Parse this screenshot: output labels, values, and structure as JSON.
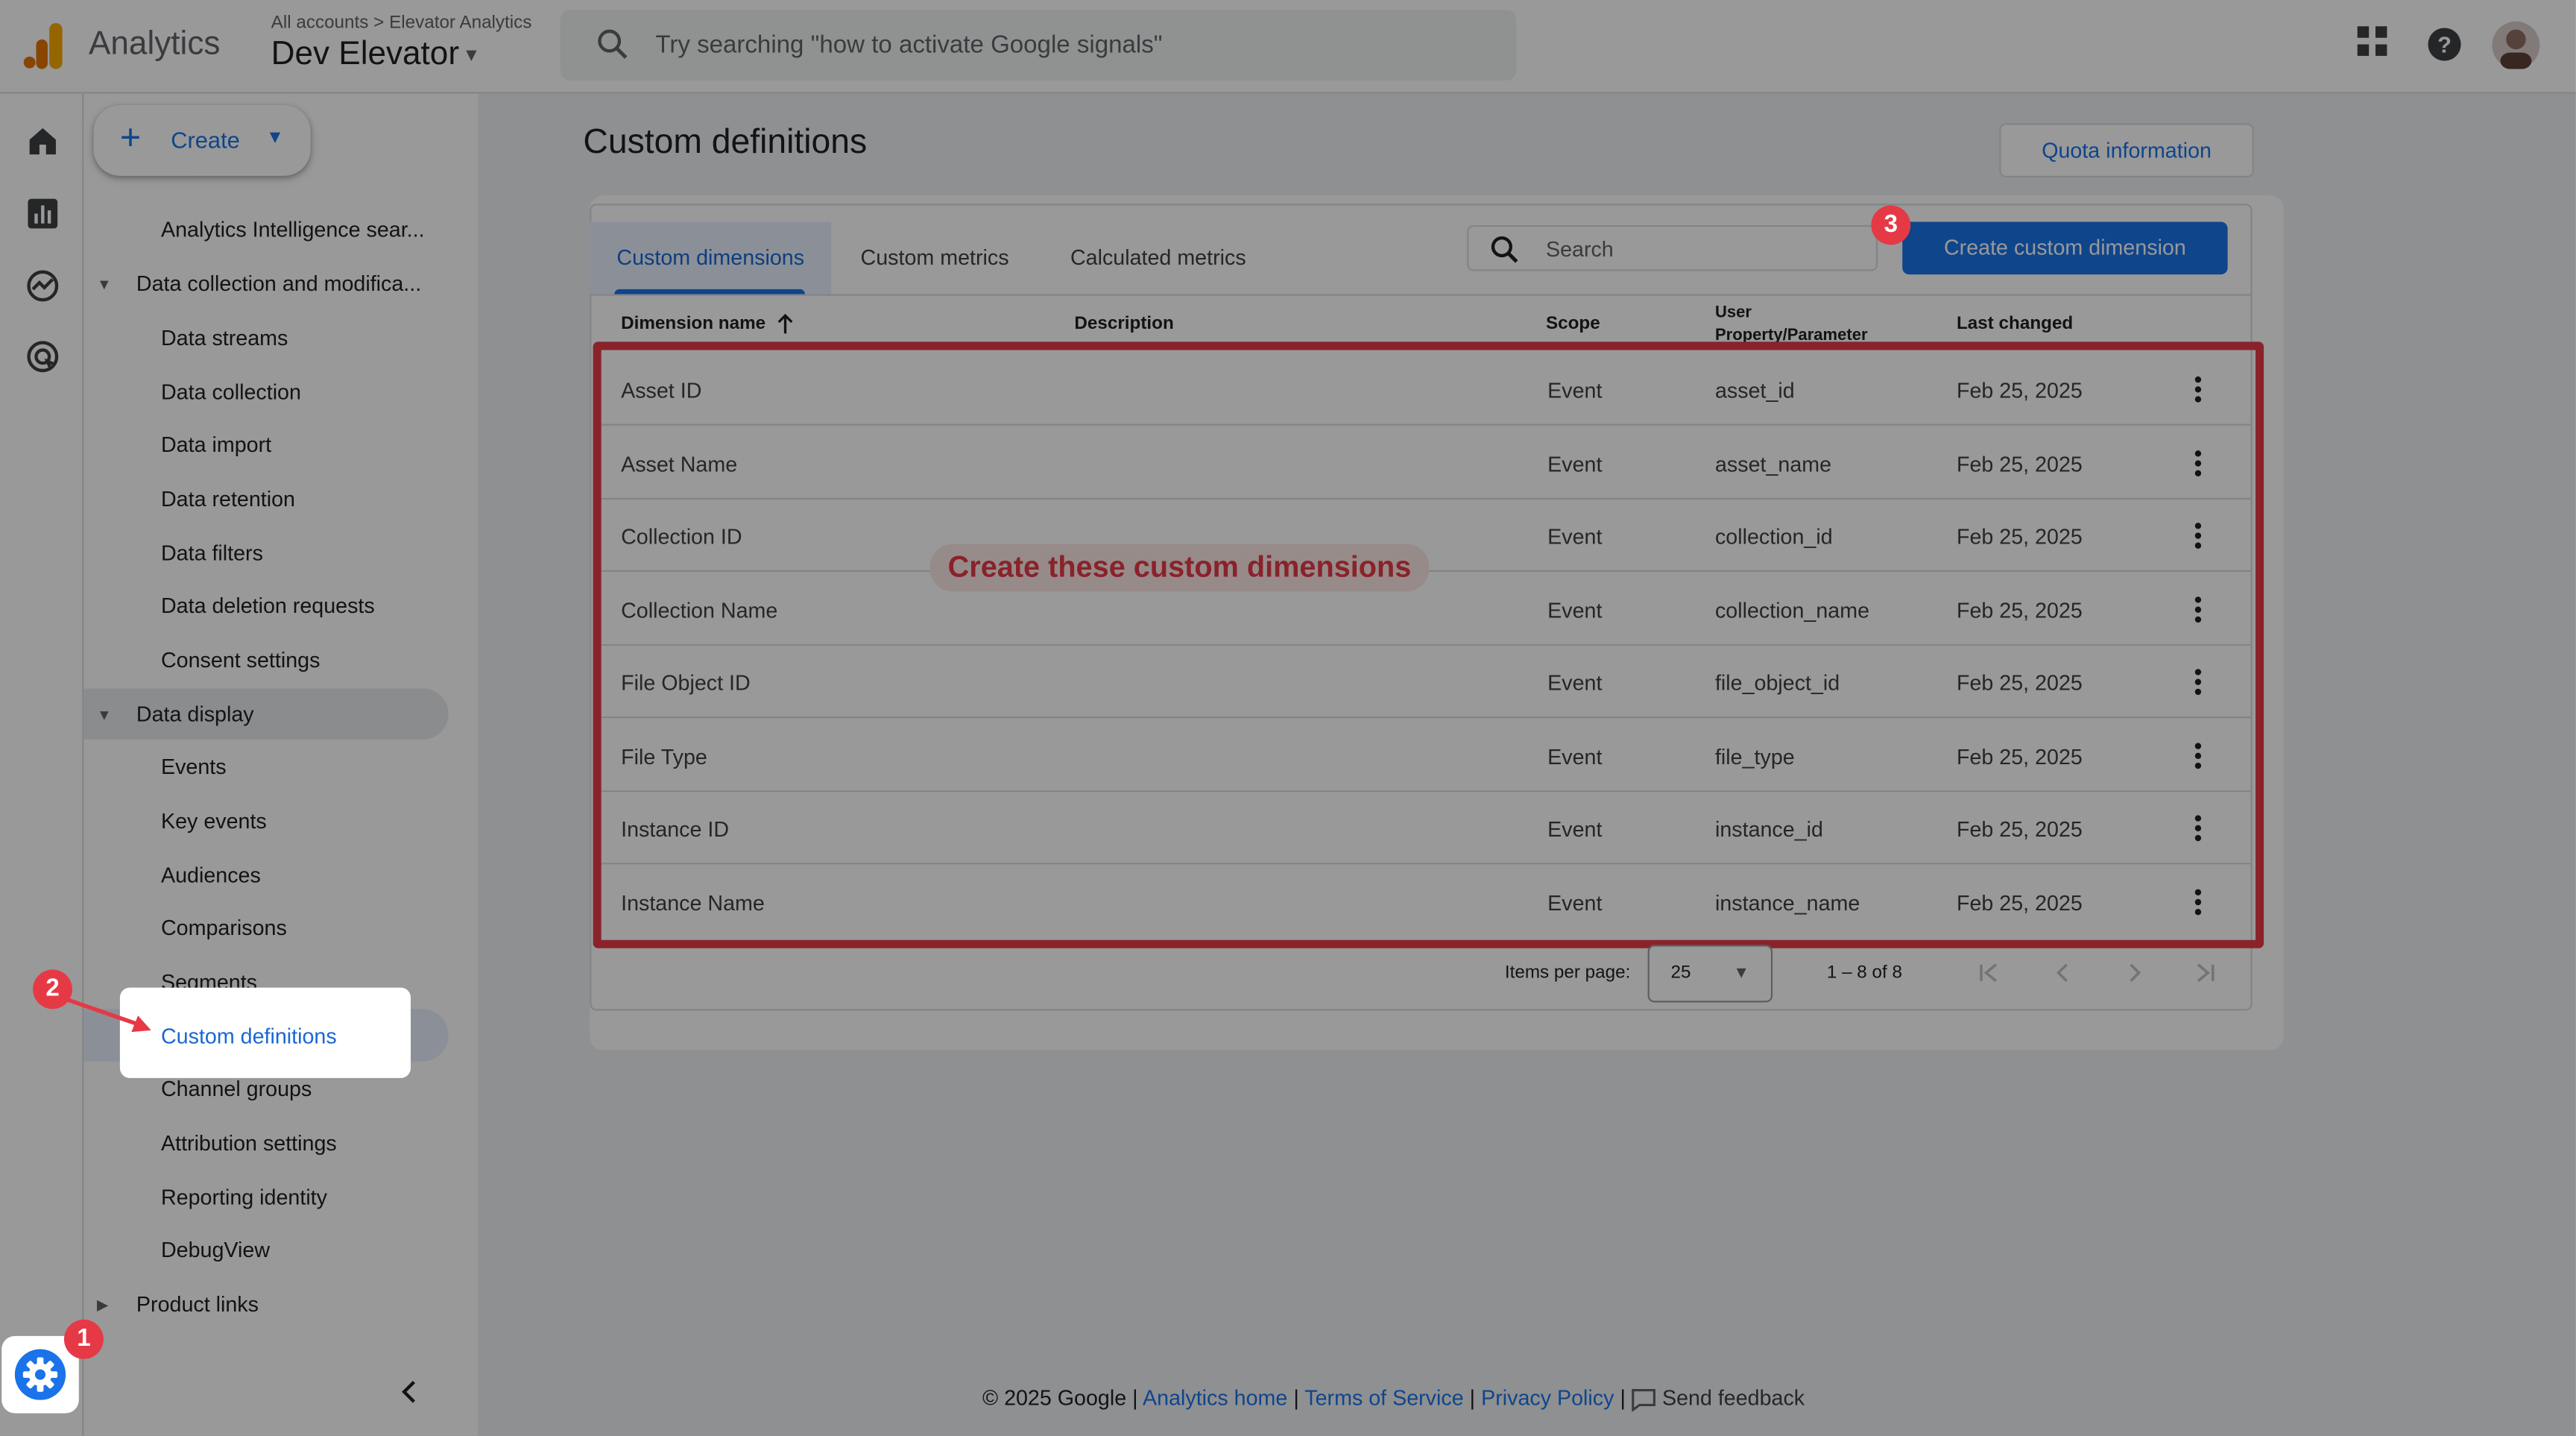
{
  "header": {
    "app_name": "Analytics",
    "breadcrumb_accounts": "All accounts",
    "breadcrumb_sep": ">",
    "breadcrumb_account": "Elevator Analytics",
    "property_name": "Dev Elevator",
    "search_placeholder": "Try searching \"how to activate Google signals\""
  },
  "nav": {
    "create_label": "Create",
    "items": [
      {
        "label": "Analytics Intelligence sear..."
      },
      {
        "label": "Data collection and modifica..."
      },
      {
        "label": "Data streams"
      },
      {
        "label": "Data collection"
      },
      {
        "label": "Data import"
      },
      {
        "label": "Data retention"
      },
      {
        "label": "Data filters"
      },
      {
        "label": "Data deletion requests"
      },
      {
        "label": "Consent settings"
      },
      {
        "label": "Data display"
      },
      {
        "label": "Events"
      },
      {
        "label": "Key events"
      },
      {
        "label": "Audiences"
      },
      {
        "label": "Comparisons"
      },
      {
        "label": "Segments"
      },
      {
        "label": "Custom definitions"
      },
      {
        "label": "Channel groups"
      },
      {
        "label": "Attribution settings"
      },
      {
        "label": "Reporting identity"
      },
      {
        "label": "DebugView"
      },
      {
        "label": "Product links"
      }
    ]
  },
  "main": {
    "title": "Custom definitions",
    "quota_button": "Quota information",
    "tabs": [
      "Custom dimensions",
      "Custom metrics",
      "Calculated metrics"
    ],
    "search_placeholder": "Search",
    "create_button": "Create custom dimension",
    "columns": [
      "Dimension name",
      "Description",
      "Scope",
      "User Property/Parameter",
      "Last changed"
    ],
    "rows": [
      {
        "name": "Asset ID",
        "scope": "Event",
        "param": "asset_id",
        "changed": "Feb 25, 2025"
      },
      {
        "name": "Asset Name",
        "scope": "Event",
        "param": "asset_name",
        "changed": "Feb 25, 2025"
      },
      {
        "name": "Collection ID",
        "scope": "Event",
        "param": "collection_id",
        "changed": "Feb 25, 2025"
      },
      {
        "name": "Collection Name",
        "scope": "Event",
        "param": "collection_name",
        "changed": "Feb 25, 2025"
      },
      {
        "name": "File Object ID",
        "scope": "Event",
        "param": "file_object_id",
        "changed": "Feb 25, 2025"
      },
      {
        "name": "File Type",
        "scope": "Event",
        "param": "file_type",
        "changed": "Feb 25, 2025"
      },
      {
        "name": "Instance ID",
        "scope": "Event",
        "param": "instance_id",
        "changed": "Feb 25, 2025"
      },
      {
        "name": "Instance Name",
        "scope": "Event",
        "param": "instance_name",
        "changed": "Feb 25, 2025"
      }
    ],
    "callout": "Create these custom dimensions",
    "pagination": {
      "label": "Items per page:",
      "value": "25",
      "range": "1 – 8 of 8"
    }
  },
  "annotations": {
    "step1": "1",
    "step2": "2",
    "step3": "3"
  },
  "footer": {
    "copyright": "© 2025 Google",
    "sep": "|",
    "analytics_home": "Analytics home",
    "terms": "Terms of Service",
    "privacy": "Privacy Policy",
    "feedback": "Send feedback"
  },
  "colors": {
    "accent": "#1a73e8",
    "annotation": "#e63946",
    "logo_orange": "#f9ab00",
    "logo_dark": "#e37400"
  },
  "icons": [
    "search-icon",
    "apps-grid-icon",
    "help-icon",
    "avatar",
    "home-icon",
    "reports-icon",
    "explore-icon",
    "advertising-icon",
    "gear-icon",
    "kebab-icon",
    "sort-arrow-icon",
    "feedback-icon"
  ]
}
